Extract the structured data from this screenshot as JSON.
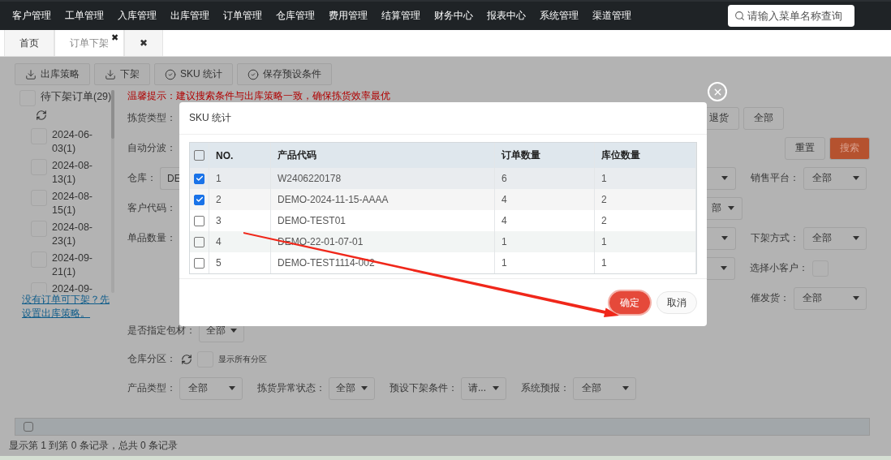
{
  "nav": {
    "items": [
      "客户管理",
      "工单管理",
      "入库管理",
      "出库管理",
      "订单管理",
      "仓库管理",
      "费用管理",
      "结算管理",
      "财务中心",
      "报表中心",
      "系统管理",
      "渠道管理"
    ],
    "search": {
      "placeholder": "请输入菜单名称查询"
    }
  },
  "tabs": [
    {
      "label": "首页",
      "selected": false
    },
    {
      "label": "订单下架",
      "close": "✖",
      "selected": true
    },
    {
      "label": "✖",
      "selected": false
    }
  ],
  "toolbar": [
    {
      "label": "出库策略",
      "kind": "download"
    },
    {
      "label": "下架",
      "kind": "download"
    },
    {
      "label": "SKU 统计",
      "kind": "check"
    },
    {
      "label": "保存预设条件",
      "kind": "check"
    }
  ],
  "sidebar": {
    "header": {
      "label": "待下架订单(29)",
      "checked": false
    },
    "items": [
      {
        "label": "2024-06-03(1)",
        "checked": false
      },
      {
        "label": "2024-08-13(1)",
        "checked": false
      },
      {
        "label": "2024-08-15(1)",
        "checked": false
      },
      {
        "label": "2024-08-23(1)",
        "checked": false
      },
      {
        "label": "2024-09-21(1)",
        "checked": false
      },
      {
        "label": "2024-09-",
        "checked": false
      }
    ],
    "link": "没有订单可下架？先设置出库策略。"
  },
  "tip": "温馨提示：建议搜索条件与出库策略一致，确保拣货效率最优",
  "form": {
    "pick_type": {
      "label": "拣货类型：",
      "options": [
        "退货",
        "全部"
      ]
    },
    "auto_wave": {
      "label": "自动分波：",
      "actions": [
        {
          "label": "重置",
          "kind": "default"
        },
        {
          "label": "搜索",
          "kind": "primary"
        }
      ]
    },
    "warehouse": {
      "label": "仓库：",
      "value": "DE"
    },
    "sales_platform": {
      "label": "销售平台：",
      "value": "全部"
    },
    "customer_code": {
      "label": "客户代码：",
      "select_value": "部"
    },
    "quantity": {
      "label": "单品数量："
    },
    "pick_method": {
      "label": "下架方式：",
      "value": "全部"
    },
    "small_customer": {
      "label": "选择小客户：",
      "checked": false
    },
    "urge": {
      "label": "催发货：",
      "value": "全部"
    },
    "packaging": {
      "label": "是否指定包材：",
      "value": "全部"
    },
    "zone": {
      "label": "仓库分区：",
      "checkbox_label": "显示所有分区",
      "checked": false
    },
    "bottom_filters": [
      {
        "label": "产品类型：",
        "value": "全部"
      },
      {
        "label": "拣货异常状态：",
        "value": "全部"
      },
      {
        "label": "预设下架条件：",
        "value": "请..."
      },
      {
        "label": "系统预报：",
        "value": "全部"
      }
    ]
  },
  "table": {
    "all_checked": false
  },
  "footer": "显示第 1 到第 0 条记录，总共 0 条记录",
  "modal": {
    "title": "SKU 统计",
    "all_checked": false,
    "columns": [
      "NO.",
      "产品代码",
      "订单数量",
      "库位数量"
    ],
    "rows": [
      {
        "no": "1",
        "code": "W2406220178",
        "orders": "6",
        "locations": "1",
        "checked": true
      },
      {
        "no": "2",
        "code": "DEMO-2024-11-15-AAAA",
        "orders": "4",
        "locations": "2",
        "checked": true
      },
      {
        "no": "3",
        "code": "DEMO-TEST01",
        "orders": "4",
        "locations": "2",
        "checked": false
      },
      {
        "no": "4",
        "code": "DEMO-22-01-07-01",
        "orders": "1",
        "locations": "1",
        "checked": false
      },
      {
        "no": "5",
        "code": "DEMO-TEST1114-002",
        "orders": "1",
        "locations": "1",
        "checked": false
      }
    ],
    "buttons": [
      {
        "label": "确定",
        "kind": "primary"
      },
      {
        "label": "取消",
        "kind": "default"
      }
    ]
  }
}
